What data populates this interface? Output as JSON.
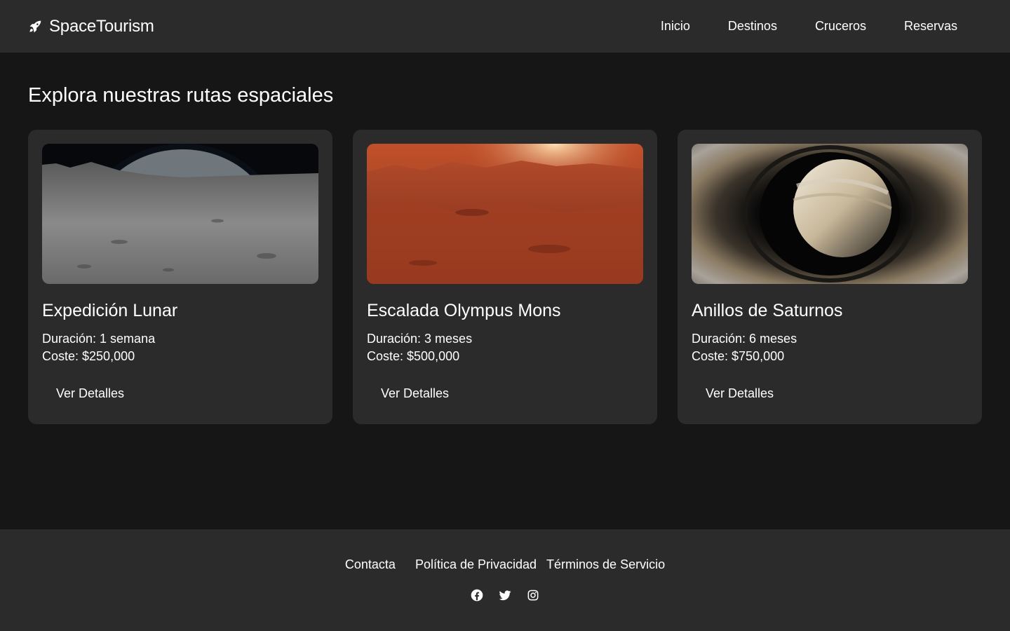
{
  "brand": {
    "name": "SpaceTourism",
    "icon": "rocket-icon"
  },
  "nav": {
    "items": [
      {
        "label": "Inicio"
      },
      {
        "label": "Destinos"
      },
      {
        "label": "Cruceros"
      },
      {
        "label": "Reservas"
      }
    ]
  },
  "main": {
    "title": "Explora nuestras rutas espaciales",
    "cards": [
      {
        "title": "Expedición Lunar",
        "duration": "Duración: 1 semana",
        "cost": "Coste: $250,000",
        "button": "Ver Detalles",
        "image": "moon-surface-image"
      },
      {
        "title": "Escalada Olympus Mons",
        "duration": "Duración: 3 meses",
        "cost": "Coste: $500,000",
        "button": "Ver Detalles",
        "image": "mars-landscape-image"
      },
      {
        "title": "Anillos de Saturnos",
        "duration": "Duración: 6 meses",
        "cost": "Coste: $750,000",
        "button": "Ver Detalles",
        "image": "saturn-rings-image"
      }
    ]
  },
  "footer": {
    "links": [
      {
        "label": "Contacta"
      },
      {
        "label": "Política de Privacidad"
      },
      {
        "label": "Términos de Servicio"
      }
    ],
    "social": [
      "facebook-icon",
      "twitter-icon",
      "instagram-icon"
    ]
  },
  "colors": {
    "background": "#161616",
    "surface": "#2b2b2b",
    "text": "#ffffff"
  }
}
